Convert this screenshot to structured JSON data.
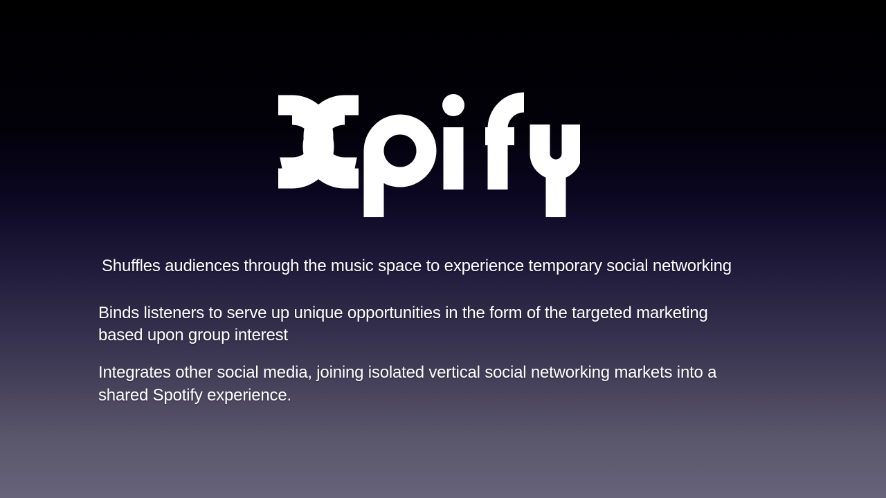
{
  "brand": {
    "name": "Xpify",
    "color": "#ffffff"
  },
  "slide": {
    "lines": [
      "Shuffles audiences through the music space to experience temporary social networking",
      "Binds listeners to serve up unique opportunities in the form of the targeted marketing",
      "based upon group interest",
      "Integrates other social media, joining isolated vertical social networking markets into a",
      "shared Spotify experience."
    ]
  },
  "colors": {
    "background_top": "#000000",
    "background_bottom": "#66637a",
    "text": "#ffffff"
  }
}
